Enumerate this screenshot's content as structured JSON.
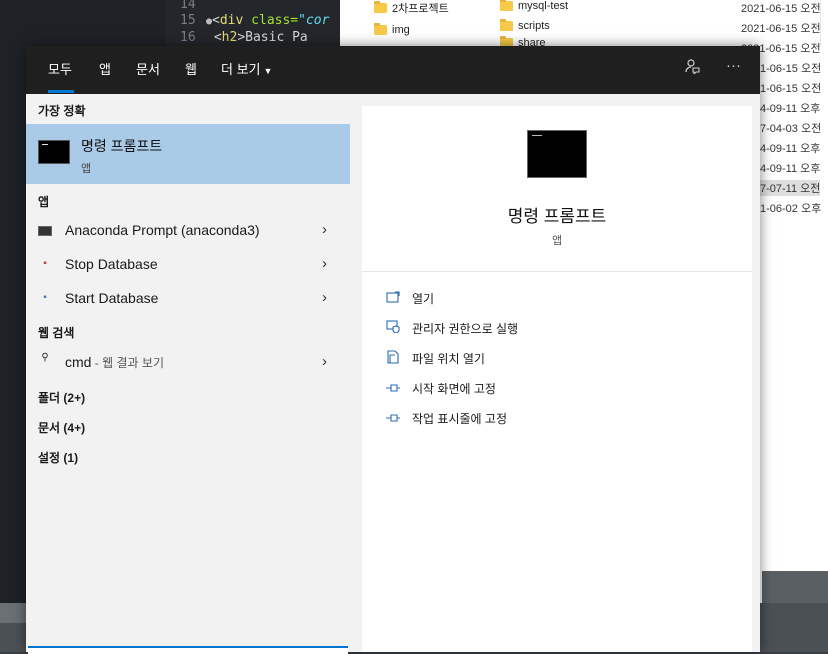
{
  "editor": {
    "lines": [
      {
        "num": "14",
        "code": ""
      },
      {
        "num": "15",
        "pre": "<",
        "tag": "div",
        "attr": " class=",
        "str": "\"cor"
      },
      {
        "num": "16",
        "pre": "  <",
        "tag": "h2",
        "rest": ">Basic Pa"
      }
    ]
  },
  "explorer": {
    "folders": [
      "2차프로젝트",
      "img",
      "mysql-test",
      "scripts",
      "share"
    ],
    "dates": [
      "2021-06-15 오전",
      "2021-06-15 오전",
      "2021-06-15 오전",
      "1-06-15 오전",
      "1-06-15 오전",
      "4-09-11 오후",
      "7-04-03 오전",
      "4-09-11 오후",
      "4-09-11 오후",
      "7-07-11 오전",
      "1-06-02 오후"
    ]
  },
  "search": {
    "tabs": {
      "all": "모두",
      "apps": "앱",
      "documents": "문서",
      "web": "웹",
      "more": "더 보기"
    },
    "more_icon": "chevron-down-icon",
    "feedback_icon": "feedback-icon",
    "options_label": "···",
    "best_match": {
      "heading": "가장 정확",
      "name": "명령 프롬프트",
      "type": "앱"
    },
    "apps_heading": "앱",
    "apps": [
      {
        "label": "Anaconda Prompt (anaconda3)",
        "icon": "terminal-icon"
      },
      {
        "label": "Stop Database",
        "icon": "stop-db-icon"
      },
      {
        "label": "Start Database",
        "icon": "start-db-icon"
      }
    ],
    "web_heading": "웹 검색",
    "web_query": "cmd",
    "web_suffix": " - 웹 결과 보기",
    "folders_label": "폴더 (2+)",
    "documents_label": "문서 (4+)",
    "settings_label": "설정 (1)",
    "preview": {
      "title": "명령 프롬프트",
      "type": "앱",
      "actions": [
        {
          "label": "열기",
          "icon": "open-icon"
        },
        {
          "label": "관리자 권한으로 실행",
          "icon": "admin-shield-icon"
        },
        {
          "label": "파일 위치 열기",
          "icon": "file-location-icon"
        },
        {
          "label": "시작 화면에 고정",
          "icon": "pin-start-icon"
        },
        {
          "label": "작업 표시줄에 고정",
          "icon": "pin-taskbar-icon"
        }
      ]
    }
  }
}
